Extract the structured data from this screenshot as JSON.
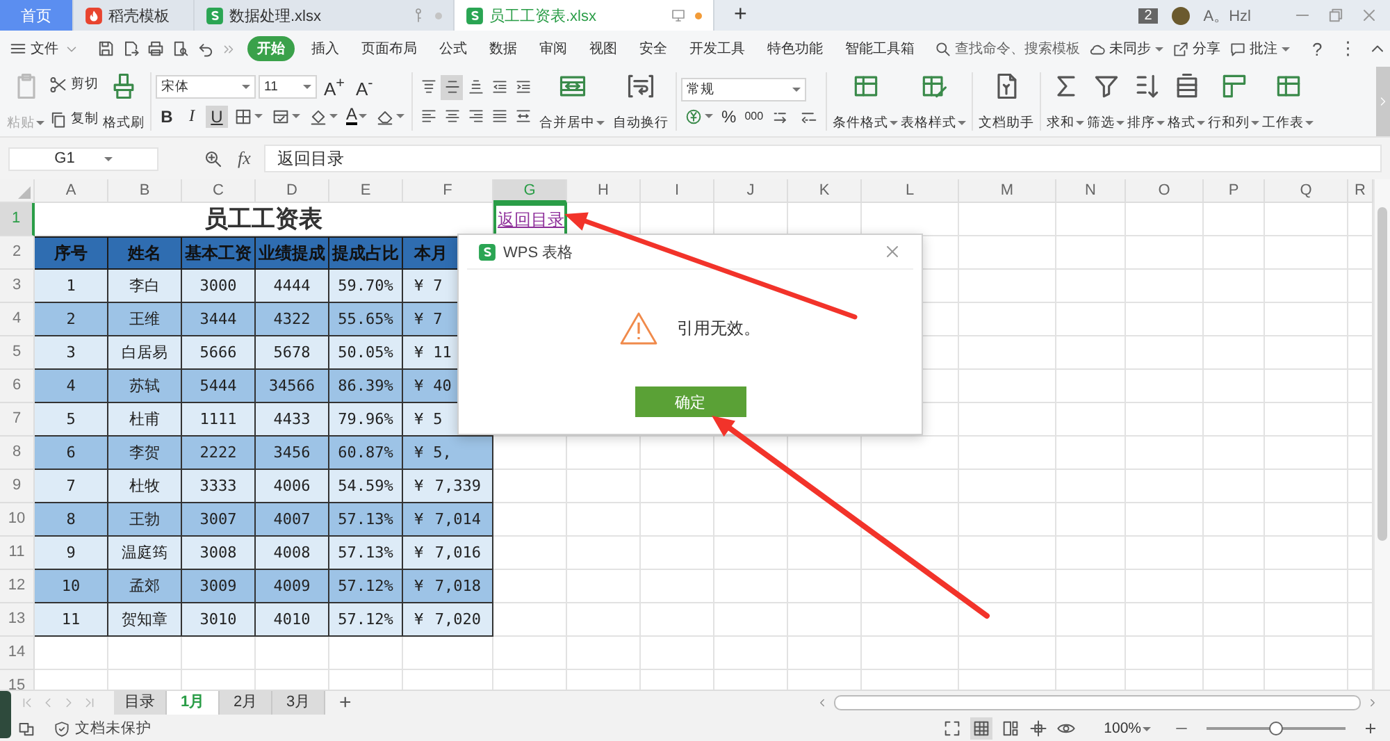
{
  "tabs": [
    {
      "label": "首页",
      "kind": "home",
      "selected": false
    },
    {
      "label": "稻壳模板",
      "kind": "docer",
      "selected": false
    },
    {
      "label": "数据处理.xlsx",
      "kind": "sheet",
      "selected": false,
      "modified": false
    },
    {
      "label": "员工工资表.xlsx",
      "kind": "sheet",
      "selected": true,
      "modified": true
    }
  ],
  "new_tab": "+",
  "doc_count": "2",
  "user": "A。Hzl",
  "menu": {
    "file": "文件",
    "items": [
      {
        "label": "开始",
        "selected": true
      },
      {
        "label": "插入",
        "selected": false
      },
      {
        "label": "页面布局",
        "selected": false
      },
      {
        "label": "公式",
        "selected": false
      },
      {
        "label": "数据",
        "selected": false
      },
      {
        "label": "审阅",
        "selected": false
      },
      {
        "label": "视图",
        "selected": false
      },
      {
        "label": "安全",
        "selected": false
      },
      {
        "label": "开发工具",
        "selected": false
      },
      {
        "label": "特色功能",
        "selected": false
      },
      {
        "label": "智能工具箱",
        "selected": false
      }
    ],
    "search": {
      "placeholder": "查找命令、搜索模板"
    },
    "actions": [
      {
        "label": "未同步",
        "kind": "cloud",
        "dropdown": true
      },
      {
        "label": "分享",
        "kind": "share",
        "dropdown": false
      },
      {
        "label": "批注",
        "kind": "comment",
        "dropdown": true
      }
    ],
    "help": "?",
    "more": "⋮"
  },
  "ribbon": {
    "clipboard": [
      {
        "label": "粘贴",
        "kind": "paste",
        "disabled": true,
        "dropdown": true
      },
      {
        "label": "剪切",
        "kind": "cut",
        "disabled": false,
        "dropdown": false
      },
      {
        "label": "复制",
        "kind": "copy",
        "disabled": false,
        "dropdown": false
      },
      {
        "label": "格式刷",
        "kind": "brush",
        "disabled": false,
        "dropdown": false
      }
    ],
    "font": {
      "family": "宋体",
      "size": "11",
      "grow": "A$^{+}$",
      "shrink": "A$^{-}$",
      "styles": [
        {
          "label": "B",
          "kind": "bold",
          "selected": false
        },
        {
          "label": "I",
          "kind": "italic",
          "selected": false
        },
        {
          "label": "U",
          "kind": "underline",
          "selected": true
        }
      ],
      "tools": [
        {
          "kind": "border",
          "dropdown": true
        },
        {
          "kind": "fill-style",
          "dropdown": true
        },
        {
          "kind": "fill",
          "dropdown": true
        },
        {
          "kind": "font-color",
          "label": "A",
          "dropdown": true
        },
        {
          "kind": "eraser",
          "dropdown": true
        }
      ]
    },
    "align": {
      "buttons": [
        {
          "kind": "top",
          "selected": false
        },
        {
          "kind": "middle",
          "selected": true
        },
        {
          "kind": "bottom",
          "selected": false
        },
        {
          "kind": "indent-dec",
          "selected": false
        },
        {
          "kind": "indent-inc",
          "selected": false
        },
        {
          "kind": "left",
          "selected": false
        },
        {
          "kind": "center",
          "selected": false
        },
        {
          "kind": "right",
          "selected": false
        },
        {
          "kind": "justify",
          "selected": false
        },
        {
          "kind": "distribute",
          "selected": false
        }
      ],
      "merge": {
        "label": "合并居中",
        "kind": "merge",
        "dropdown": true
      },
      "wrap": {
        "label": "自动换行",
        "kind": "wrap",
        "dropdown": false
      }
    },
    "number": {
      "format": "常规",
      "buttons": [
        {
          "kind": "currency",
          "dropdown": true
        },
        {
          "kind": "percent",
          "label": "%",
          "dropdown": false
        },
        {
          "kind": "thousands",
          "label": "000",
          "dropdown": false
        },
        {
          "kind": "dec-inc",
          "dropdown": false
        },
        {
          "kind": "dec-dec",
          "dropdown": false
        }
      ]
    },
    "tools": [
      {
        "label": "条件格式",
        "kind": "cond",
        "dropdown": true
      },
      {
        "label": "表格样式",
        "kind": "table-style",
        "dropdown": true
      },
      {
        "label": "文档助手",
        "kind": "doc",
        "dropdown": false
      },
      {
        "label": "求和",
        "kind": "sum",
        "dropdown": true
      },
      {
        "label": "筛选",
        "kind": "filter",
        "dropdown": true
      },
      {
        "label": "排序",
        "kind": "sort",
        "dropdown": true
      },
      {
        "label": "格式",
        "kind": "format",
        "dropdown": true
      },
      {
        "label": "行和列",
        "kind": "rowcol",
        "dropdown": true
      },
      {
        "label": "工作表",
        "kind": "sheet",
        "dropdown": true
      }
    ]
  },
  "formula_bar": {
    "cell": "G1",
    "fx": "fx",
    "value": "返回目录"
  },
  "columns": [
    {
      "label": "A",
      "selected": false
    },
    {
      "label": "B",
      "selected": false
    },
    {
      "label": "C",
      "selected": false
    },
    {
      "label": "D",
      "selected": false
    },
    {
      "label": "E",
      "selected": false
    },
    {
      "label": "F",
      "selected": false
    },
    {
      "label": "G",
      "selected": true
    },
    {
      "label": "H",
      "selected": false
    },
    {
      "label": "I",
      "selected": false
    },
    {
      "label": "J",
      "selected": false
    },
    {
      "label": "K",
      "selected": false
    },
    {
      "label": "L",
      "selected": false
    },
    {
      "label": "M",
      "selected": false
    },
    {
      "label": "N",
      "selected": false
    },
    {
      "label": "O",
      "selected": false
    },
    {
      "label": "P",
      "selected": false
    },
    {
      "label": "Q",
      "selected": false
    },
    {
      "label": "R",
      "selected": false
    }
  ],
  "rows": [
    {
      "label": "1",
      "selected": true
    },
    {
      "label": "2",
      "selected": false
    },
    {
      "label": "3",
      "selected": false
    },
    {
      "label": "4",
      "selected": false
    },
    {
      "label": "5",
      "selected": false
    },
    {
      "label": "6",
      "selected": false
    },
    {
      "label": "7",
      "selected": false
    },
    {
      "label": "8",
      "selected": false
    },
    {
      "label": "9",
      "selected": false
    },
    {
      "label": "10",
      "selected": false
    },
    {
      "label": "11",
      "selected": false
    },
    {
      "label": "12",
      "selected": false
    },
    {
      "label": "13",
      "selected": false
    },
    {
      "label": "14",
      "selected": false
    },
    {
      "label": "15",
      "selected": false
    }
  ],
  "table": {
    "title": "员工工资表",
    "link": "返回目录",
    "headers": [
      "序号",
      "姓名",
      "基本工资",
      "业绩提成",
      "提成占比",
      "本月"
    ],
    "rows": [
      {
        "cells": [
          "1",
          "李白",
          "3000",
          "4444",
          "59.70%"
        ],
        "currency": "¥",
        "amount": "7"
      },
      {
        "cells": [
          "2",
          "王维",
          "3444",
          "4322",
          "55.65%"
        ],
        "currency": "¥",
        "amount": "7"
      },
      {
        "cells": [
          "3",
          "白居易",
          "5666",
          "5678",
          "50.05%"
        ],
        "currency": "¥",
        "amount": "11"
      },
      {
        "cells": [
          "4",
          "苏轼",
          "5444",
          "34566",
          "86.39%"
        ],
        "currency": "¥",
        "amount": "40"
      },
      {
        "cells": [
          "5",
          "杜甫",
          "1111",
          "4433",
          "79.96%"
        ],
        "currency": "¥",
        "amount": "5"
      },
      {
        "cells": [
          "6",
          "李贺",
          "2222",
          "3456",
          "60.87%"
        ],
        "currency": "¥",
        "amount": "5,"
      },
      {
        "cells": [
          "7",
          "杜牧",
          "3333",
          "4006",
          "54.59%"
        ],
        "currency": "¥",
        "amount": "7,339"
      },
      {
        "cells": [
          "8",
          "王勃",
          "3007",
          "4007",
          "57.13%"
        ],
        "currency": "¥",
        "amount": "7,014"
      },
      {
        "cells": [
          "9",
          "温庭筠",
          "3008",
          "4008",
          "57.13%"
        ],
        "currency": "¥",
        "amount": "7,016"
      },
      {
        "cells": [
          "10",
          "孟郊",
          "3009",
          "4009",
          "57.12%"
        ],
        "currency": "¥",
        "amount": "7,018"
      },
      {
        "cells": [
          "11",
          "贺知章",
          "3010",
          "4010",
          "57.12%"
        ],
        "currency": "¥",
        "amount": "7,020"
      }
    ]
  },
  "dialog": {
    "title": "WPS 表格",
    "message": "引用无效。",
    "button": "确定"
  },
  "sheet_tabs": [
    {
      "label": "目录",
      "selected": false
    },
    {
      "label": "1月",
      "selected": true
    },
    {
      "label": "2月",
      "selected": false
    },
    {
      "label": "3月",
      "selected": false
    }
  ],
  "add_sheet": "+",
  "status_bar": {
    "protection": "文档未保护",
    "zoom": "100%",
    "zoom_slider": {
      "level": 0.5
    }
  }
}
